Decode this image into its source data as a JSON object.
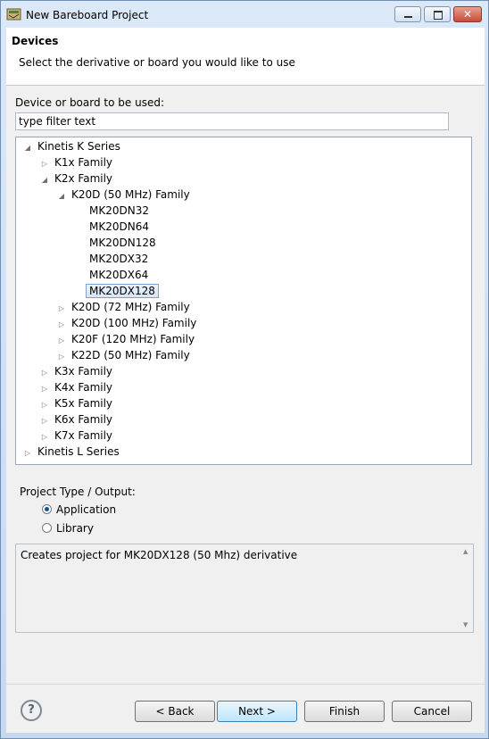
{
  "window": {
    "title": "New Bareboard Project"
  },
  "header": {
    "title": "Devices",
    "subtitle": "Select the derivative or board you would like to use"
  },
  "device_label": "Device or board to be used:",
  "filter": {
    "value": "type filter text"
  },
  "tree": {
    "rows": [
      {
        "label": "Kinetis K Series",
        "expanded": true
      },
      {
        "label": "K1x Family",
        "expanded": false
      },
      {
        "label": "K2x Family",
        "expanded": true
      },
      {
        "label": "K20D (50 MHz) Family",
        "expanded": true
      },
      {
        "label": "MK20DN32"
      },
      {
        "label": "MK20DN64"
      },
      {
        "label": "MK20DN128"
      },
      {
        "label": "MK20DX32"
      },
      {
        "label": "MK20DX64"
      },
      {
        "label": "MK20DX128",
        "selected": true
      },
      {
        "label": "K20D (72 MHz) Family",
        "expanded": false
      },
      {
        "label": "K20D (100 MHz) Family",
        "expanded": false
      },
      {
        "label": "K20F (120 MHz) Family",
        "expanded": false
      },
      {
        "label": "K22D (50 MHz) Family",
        "expanded": false
      },
      {
        "label": "K3x Family",
        "expanded": false
      },
      {
        "label": "K4x Family",
        "expanded": false
      },
      {
        "label": "K5x Family",
        "expanded": false
      },
      {
        "label": "K6x Family",
        "expanded": false
      },
      {
        "label": "K7x Family",
        "expanded": false
      },
      {
        "label": "Kinetis L Series",
        "expanded": false
      }
    ]
  },
  "project_type": {
    "label": "Project Type / Output:",
    "options": [
      {
        "label": "Application",
        "checked": true
      },
      {
        "label": "Library",
        "checked": false
      }
    ]
  },
  "description": "Creates project for MK20DX128 (50 Mhz) derivative",
  "buttons": {
    "back": "< Back",
    "next": "Next >",
    "finish": "Finish",
    "cancel": "Cancel"
  },
  "icons": {
    "app": "eclipse-project-icon",
    "help": "help-icon",
    "expand": "expand-arrow-icon",
    "collapse": "collapse-arrow-icon"
  }
}
